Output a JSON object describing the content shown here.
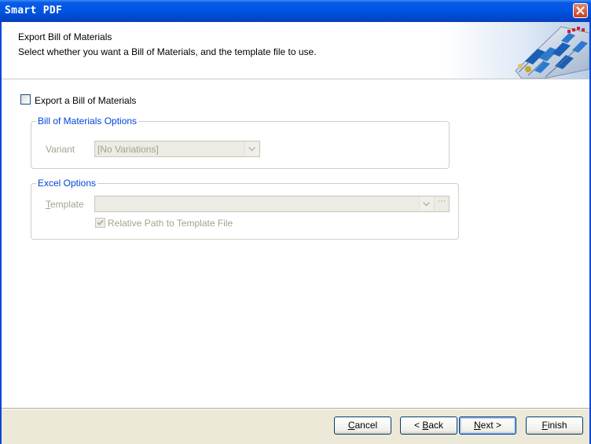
{
  "window": {
    "title": "Smart PDF"
  },
  "header": {
    "title": "Export Bill of Materials",
    "description": "Select whether you want a Bill of Materials, and the template file to use."
  },
  "export_bom": {
    "label": "Export a Bill of Materials",
    "checked": false
  },
  "bom_options": {
    "legend": "Bill of Materials Options",
    "variant_label": "Variant",
    "variant_value": "[No Variations]"
  },
  "excel_options": {
    "legend": "Excel Options",
    "template_label": "Template",
    "template_value": "",
    "ellipsis": "···",
    "relative_path_label": "Relative Path to Template File",
    "relative_path_checked": true
  },
  "buttons": {
    "cancel": {
      "mnemonic": "C",
      "rest": "ancel"
    },
    "back": {
      "prefix": "< ",
      "mnemonic": "B",
      "rest": "ack"
    },
    "next": {
      "mnemonic": "N",
      "rest": "ext >"
    },
    "finish": {
      "mnemonic": "F",
      "rest": "inish"
    }
  },
  "colors": {
    "titlebar": "#0054e3",
    "legend": "#0046d5",
    "disabled_text": "#a3a38f",
    "button_face": "#ece9d8"
  }
}
